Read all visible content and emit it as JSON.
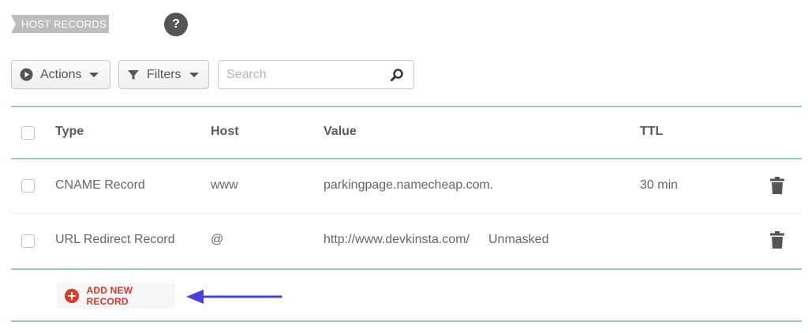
{
  "section": {
    "title": "HOST RECORDS",
    "help_label": "?"
  },
  "toolbar": {
    "actions_label": "Actions",
    "filters_label": "Filters",
    "search_placeholder": "Search",
    "search_value": ""
  },
  "table": {
    "headers": {
      "type": "Type",
      "host": "Host",
      "value": "Value",
      "ttl": "TTL"
    },
    "rows": [
      {
        "type": "CNAME Record",
        "host": "www",
        "value": "parkingpage.namecheap.com.",
        "extra": "",
        "ttl": "30 min"
      },
      {
        "type": "URL Redirect Record",
        "host": "@",
        "value": "http://www.devkinsta.com/",
        "extra": "Unmasked",
        "ttl": ""
      }
    ]
  },
  "add_record": {
    "label": "ADD NEW RECORD"
  },
  "colors": {
    "accent_red": "#e2352b",
    "rule_green": "#9cc9bd",
    "arrow_blue": "#4a3fe0"
  },
  "icons": [
    "play-icon",
    "filter-icon",
    "caret-down-icon",
    "search-icon",
    "trash-icon",
    "plus-circle-icon",
    "arrow-left-icon"
  ]
}
